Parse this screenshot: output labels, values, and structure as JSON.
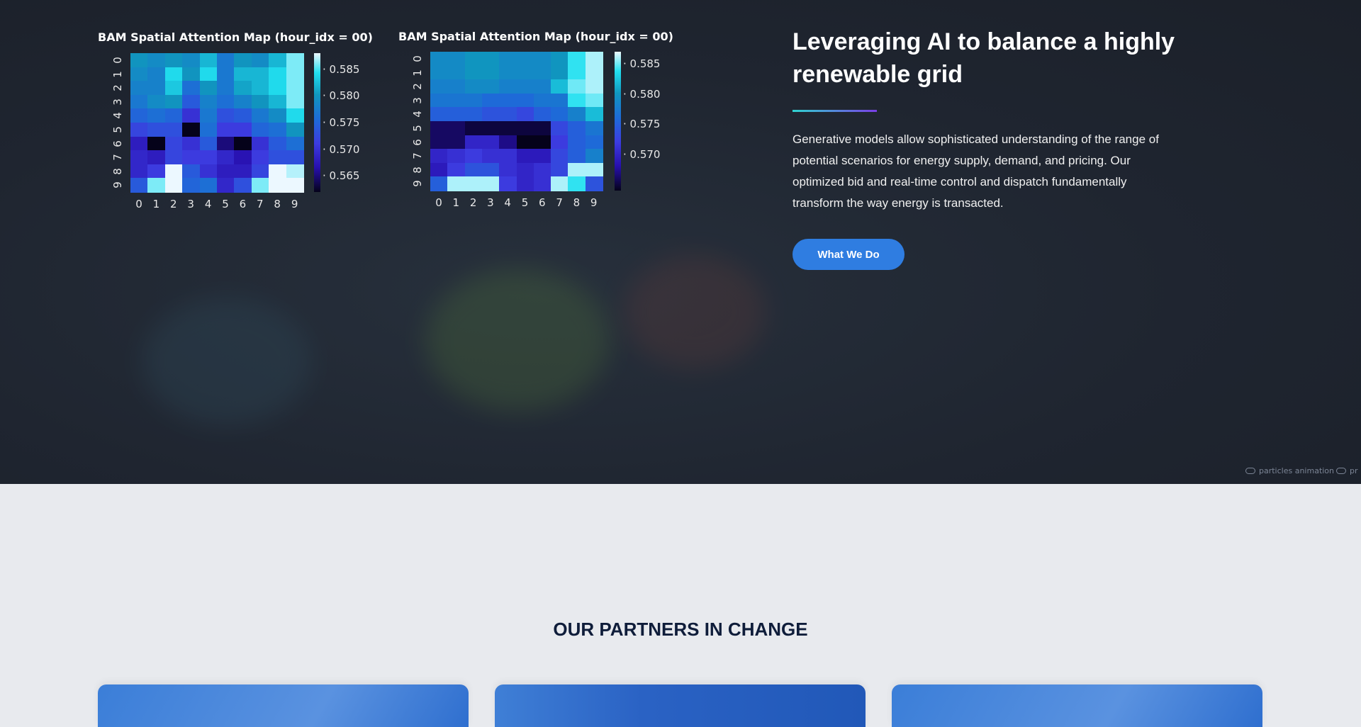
{
  "heatmaps": [
    {
      "title": "BAM Spatial Attention Map (hour_idx = 00)",
      "x_ticks": [
        "0",
        "1",
        "2",
        "3",
        "4",
        "5",
        "6",
        "7",
        "8",
        "9"
      ],
      "y_ticks": [
        "0",
        "1",
        "2",
        "3",
        "4",
        "5",
        "6",
        "7",
        "8",
        "9"
      ],
      "colorbar_ticks": [
        "0.585",
        "0.580",
        "0.575",
        "0.570",
        "0.565"
      ],
      "range": [
        0.562,
        0.588
      ],
      "values": [
        [
          0.58,
          0.579,
          0.58,
          0.579,
          0.582,
          0.577,
          0.58,
          0.579,
          0.582,
          0.586
        ],
        [
          0.579,
          0.578,
          0.584,
          0.58,
          0.584,
          0.577,
          0.582,
          0.582,
          0.584,
          0.586
        ],
        [
          0.578,
          0.578,
          0.583,
          0.576,
          0.58,
          0.577,
          0.581,
          0.582,
          0.584,
          0.586
        ],
        [
          0.577,
          0.579,
          0.58,
          0.574,
          0.578,
          0.576,
          0.578,
          0.58,
          0.582,
          0.586
        ],
        [
          0.575,
          0.576,
          0.575,
          0.57,
          0.577,
          0.573,
          0.574,
          0.577,
          0.579,
          0.584
        ],
        [
          0.572,
          0.573,
          0.573,
          0.562,
          0.576,
          0.571,
          0.571,
          0.575,
          0.576,
          0.58
        ],
        [
          0.568,
          0.562,
          0.572,
          0.57,
          0.574,
          0.565,
          0.562,
          0.57,
          0.574,
          0.576
        ],
        [
          0.569,
          0.568,
          0.572,
          0.571,
          0.571,
          0.569,
          0.567,
          0.571,
          0.573,
          0.573
        ],
        [
          0.569,
          0.571,
          0.588,
          0.574,
          0.57,
          0.568,
          0.568,
          0.572,
          0.588,
          0.587
        ],
        [
          0.574,
          0.586,
          0.588,
          0.575,
          0.576,
          0.569,
          0.573,
          0.586,
          0.588,
          0.588
        ]
      ]
    },
    {
      "title": "BAM Spatial Attention Map (hour_idx = 00)",
      "x_ticks": [
        "0",
        "1",
        "2",
        "3",
        "4",
        "5",
        "6",
        "7",
        "8",
        "9"
      ],
      "y_ticks": [
        "0",
        "1",
        "2",
        "3",
        "4",
        "5",
        "6",
        "7",
        "8",
        "9"
      ],
      "colorbar_ticks": [
        "0.585",
        "0.580",
        "0.575",
        "0.570"
      ],
      "range": [
        0.564,
        0.587
      ],
      "values": [
        [
          0.579,
          0.579,
          0.58,
          0.58,
          0.579,
          0.579,
          0.579,
          0.58,
          0.584,
          0.586
        ],
        [
          0.579,
          0.579,
          0.58,
          0.58,
          0.579,
          0.579,
          0.579,
          0.58,
          0.584,
          0.586
        ],
        [
          0.578,
          0.578,
          0.579,
          0.579,
          0.578,
          0.578,
          0.578,
          0.582,
          0.585,
          0.586
        ],
        [
          0.577,
          0.577,
          0.577,
          0.576,
          0.576,
          0.576,
          0.577,
          0.577,
          0.584,
          0.585
        ],
        [
          0.575,
          0.575,
          0.575,
          0.574,
          0.574,
          0.573,
          0.575,
          0.576,
          0.578,
          0.582
        ],
        [
          0.566,
          0.566,
          0.565,
          0.565,
          0.565,
          0.565,
          0.565,
          0.573,
          0.575,
          0.577
        ],
        [
          0.566,
          0.566,
          0.57,
          0.57,
          0.567,
          0.564,
          0.564,
          0.572,
          0.575,
          0.576
        ],
        [
          0.57,
          0.571,
          0.572,
          0.571,
          0.571,
          0.569,
          0.569,
          0.573,
          0.575,
          0.578
        ],
        [
          0.569,
          0.572,
          0.574,
          0.574,
          0.571,
          0.57,
          0.571,
          0.573,
          0.586,
          0.586
        ],
        [
          0.575,
          0.586,
          0.586,
          0.586,
          0.572,
          0.57,
          0.571,
          0.586,
          0.584,
          0.574
        ]
      ]
    }
  ],
  "hero": {
    "headline": "Leveraging AI to balance a highly renewable grid",
    "description": "Generative models allow sophisticated understanding of the range of potential scenarios for energy supply, demand, and pricing. Our optimized bid and real-time control and dispatch fundamentally transform the way energy is transacted.",
    "cta_label": "What We Do",
    "accent": "#2f7de1"
  },
  "map_controls": {
    "particles_label": "particles animation",
    "second_label": "pr"
  },
  "partners": {
    "title": "OUR PARTNERS IN CHANGE"
  }
}
